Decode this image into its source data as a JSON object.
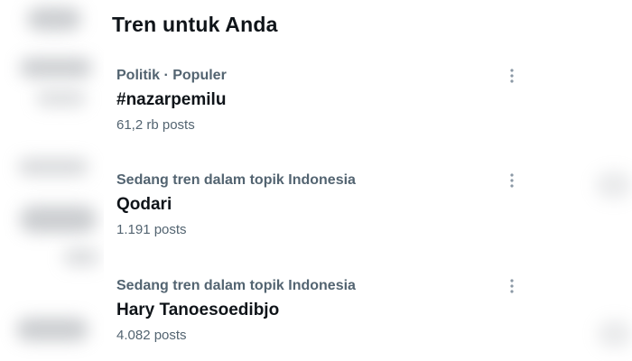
{
  "trends": {
    "title": "Tren untuk Anda",
    "items": [
      {
        "context": "Politik · Populer",
        "name": "#nazarpemilu",
        "count": "61,2 rb posts"
      },
      {
        "context": "Sedang tren dalam topik Indonesia",
        "name": "Qodari",
        "count": "1.191 posts"
      },
      {
        "context": "Sedang tren dalam topik Indonesia",
        "name": "Hary Tanoesoedibjo",
        "count": "4.082 posts"
      }
    ]
  },
  "icons": {
    "more": "more-dots-icon"
  },
  "colors": {
    "primary_text": "#0f1419",
    "secondary_text": "#536471",
    "background": "#ffffff"
  }
}
